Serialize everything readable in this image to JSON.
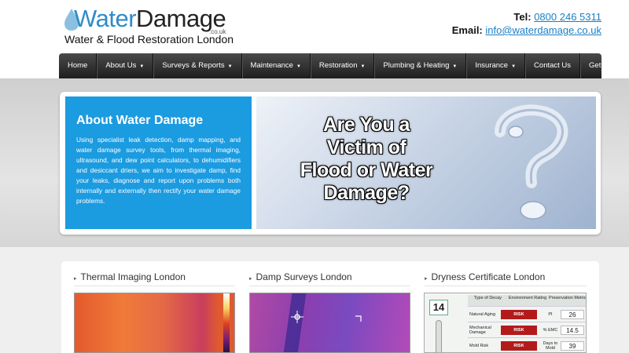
{
  "header": {
    "logo_water": "Water",
    "logo_damage": "Damage",
    "logo_couk": ".co.uk",
    "tagline": "Water & Flood Restoration London",
    "tel_label": "Tel:",
    "tel_value": "0800 246 5311",
    "email_label": "Email:",
    "email_value": "info@waterdamage.co.uk"
  },
  "nav": {
    "items": [
      {
        "label": "Home",
        "dropdown": false
      },
      {
        "label": "About Us",
        "dropdown": true
      },
      {
        "label": "Surveys & Reports",
        "dropdown": true
      },
      {
        "label": "Maintenance",
        "dropdown": true
      },
      {
        "label": "Restoration",
        "dropdown": true
      },
      {
        "label": "Plumbing & Heating",
        "dropdown": true
      },
      {
        "label": "Insurance",
        "dropdown": true
      },
      {
        "label": "Contact Us",
        "dropdown": false
      },
      {
        "label": "Get a Quote",
        "dropdown": false
      }
    ]
  },
  "about": {
    "title": "About Water Damage",
    "body": "Using specialist leak detection, damp mapping, and water damage survey tools, from thermal imaging, ultrasound, and dew point calculators, to dehumidifiers and desiccant driers, we aim to investigate damp, find your leaks, diagnose and report upon problems both internally and externally then rectify your water damage problems."
  },
  "hero": {
    "line1": "Are You a",
    "line2": "Victim of",
    "line3": "Flood or Water",
    "line4": "Damage?"
  },
  "features": [
    {
      "title": "Thermal Imaging London"
    },
    {
      "title": "Damp Surveys London"
    },
    {
      "title": "Dryness Certificate London"
    }
  ],
  "certificate": {
    "gauge_value": "14",
    "headers": [
      "Type of Decay",
      "Environment Rating",
      "Preservation Metric"
    ],
    "rows": [
      {
        "type": "Natural Aging",
        "rating": "RISK",
        "metric": "PI",
        "value": "26"
      },
      {
        "type": "Mechanical Damage",
        "rating": "RISK",
        "metric": "% EMC",
        "value": "14.5"
      },
      {
        "type": "Mold Risk",
        "rating": "RISK",
        "metric": "Days to Mold",
        "value": "39"
      }
    ]
  },
  "colors": {
    "brand_blue": "#2e8cc9",
    "about_bg": "#1b9be0",
    "nav_bg": "#2a2a2a",
    "risk_red": "#b31b1b"
  }
}
